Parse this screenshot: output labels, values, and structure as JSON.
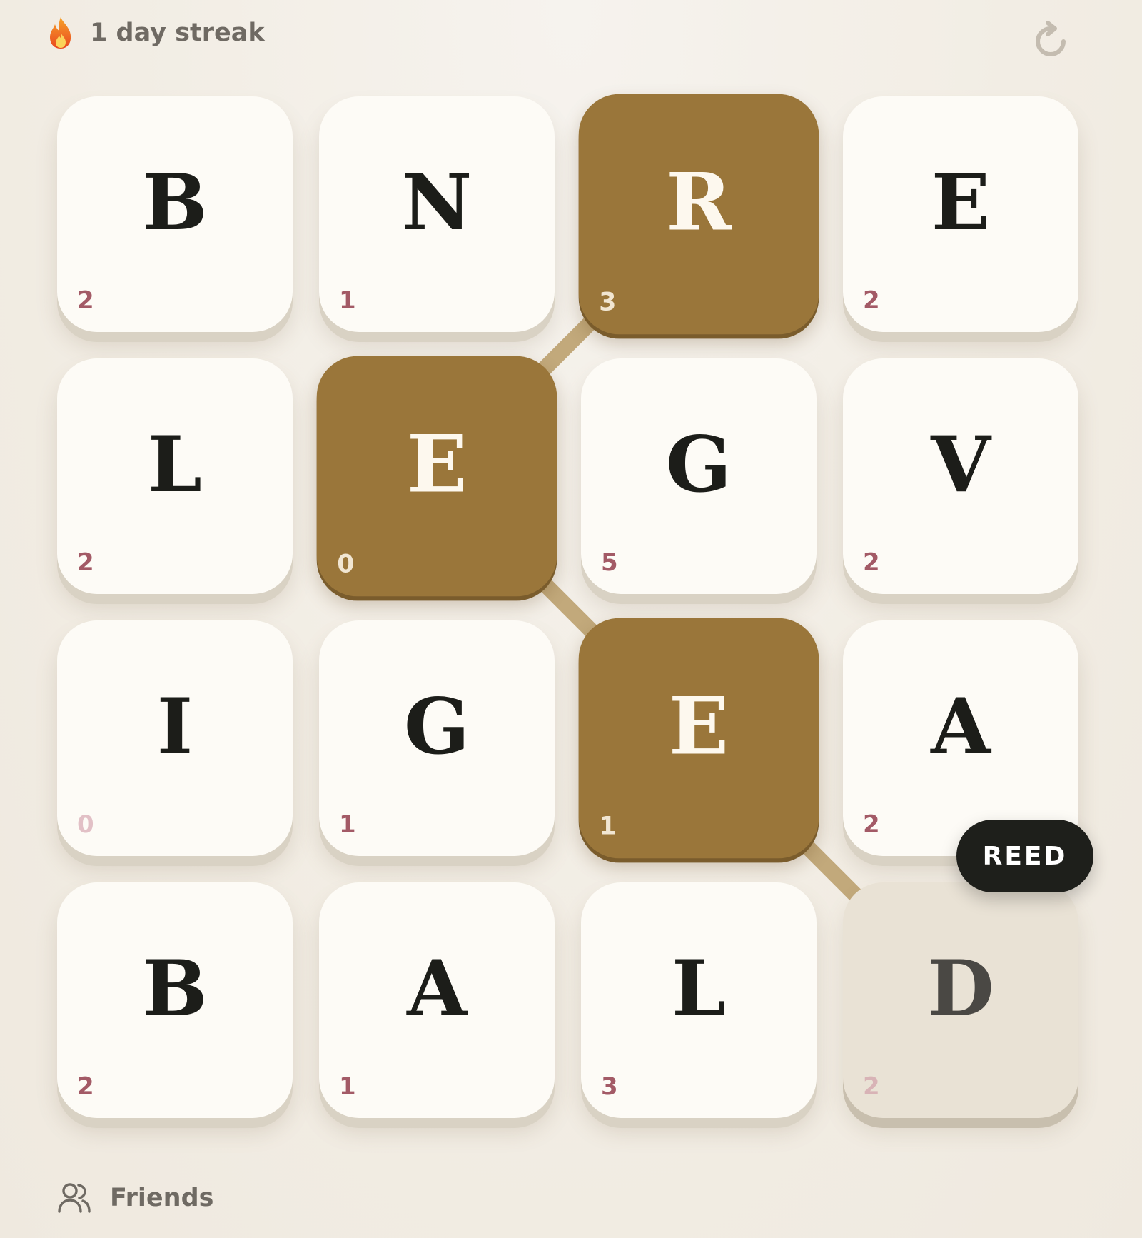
{
  "header": {
    "streak_text": "1 day streak",
    "streak_icon": "flame-icon",
    "refresh_icon": "refresh-icon"
  },
  "board": {
    "rows": 4,
    "cols": 4,
    "tiles": [
      {
        "letter": "B",
        "count": "2",
        "state": "normal"
      },
      {
        "letter": "N",
        "count": "1",
        "state": "normal"
      },
      {
        "letter": "R",
        "count": "3",
        "state": "selected"
      },
      {
        "letter": "E",
        "count": "2",
        "state": "normal"
      },
      {
        "letter": "L",
        "count": "2",
        "state": "normal"
      },
      {
        "letter": "E",
        "count": "0",
        "state": "selected"
      },
      {
        "letter": "G",
        "count": "5",
        "state": "normal"
      },
      {
        "letter": "V",
        "count": "2",
        "state": "normal"
      },
      {
        "letter": "I",
        "count": "0",
        "state": "normal"
      },
      {
        "letter": "G",
        "count": "1",
        "state": "normal"
      },
      {
        "letter": "E",
        "count": "1",
        "state": "selected"
      },
      {
        "letter": "A",
        "count": "2",
        "state": "normal"
      },
      {
        "letter": "B",
        "count": "2",
        "state": "normal"
      },
      {
        "letter": "A",
        "count": "1",
        "state": "normal"
      },
      {
        "letter": "L",
        "count": "3",
        "state": "normal"
      },
      {
        "letter": "D",
        "count": "2",
        "state": "pending"
      }
    ],
    "path": [
      2,
      5,
      10,
      15
    ],
    "current_word": "REED",
    "colors": {
      "selected_tile": "#9a763a",
      "path_line": "#c2a97b",
      "count_text": "#a35a66",
      "word_badge": "#1e1f1b"
    }
  },
  "footer": {
    "friends_label": "Friends",
    "friends_icon": "users-icon"
  }
}
